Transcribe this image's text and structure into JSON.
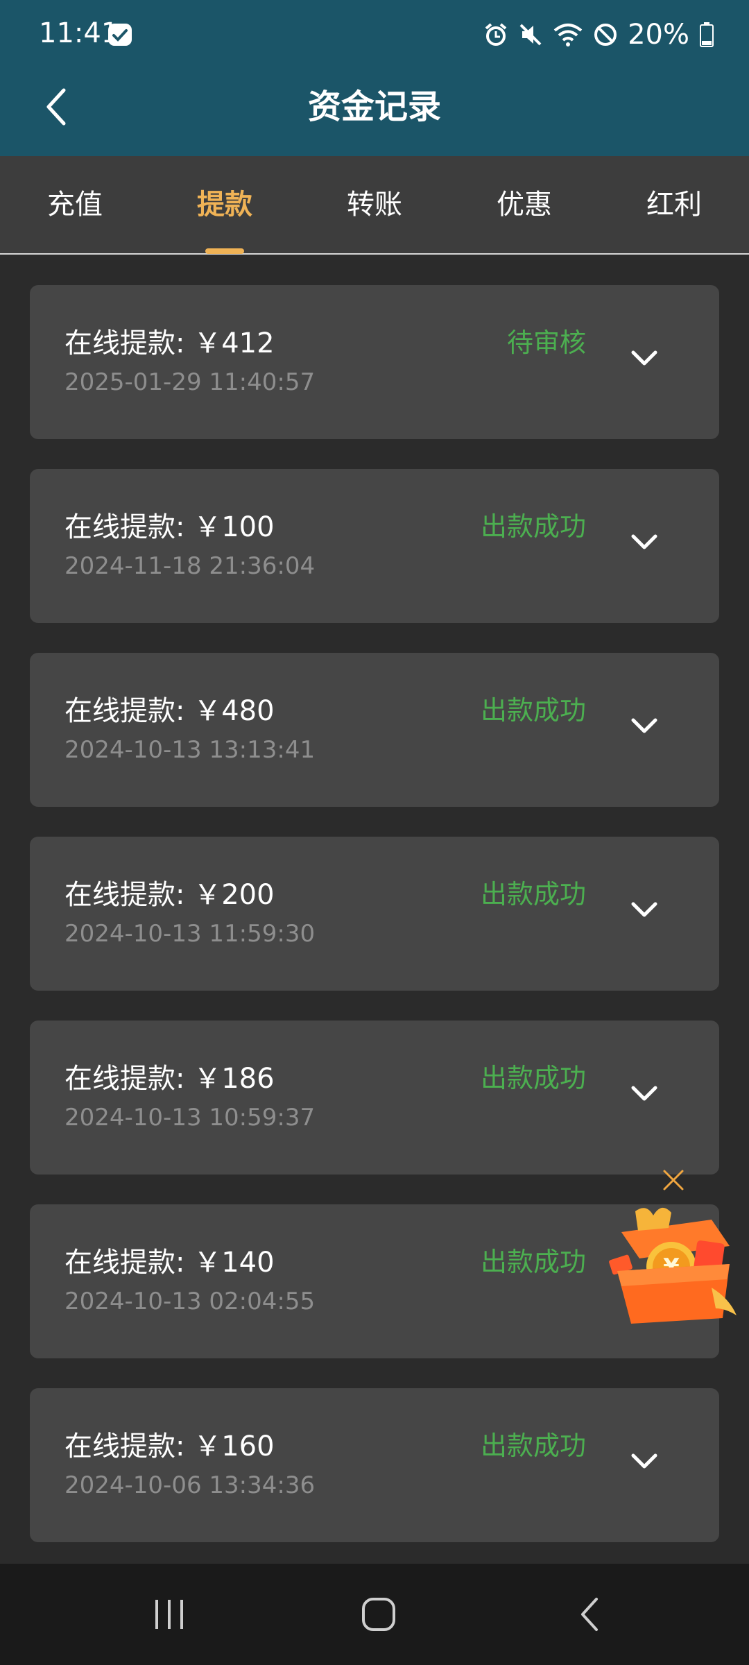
{
  "status_bar": {
    "time": "11:41",
    "battery": "20%",
    "icons": [
      "alarm-icon",
      "mute-icon",
      "wifi-icon",
      "dnd-icon",
      "battery-icon"
    ]
  },
  "header": {
    "title": "资金记录",
    "back_icon": "chevron-left-icon",
    "background": "#1b5568"
  },
  "tabs": [
    {
      "label": "充值",
      "active": false
    },
    {
      "label": "提款",
      "active": true
    },
    {
      "label": "转账",
      "active": false
    },
    {
      "label": "优惠",
      "active": false
    },
    {
      "label": "红利",
      "active": false
    }
  ],
  "accent_color": "#f0b356",
  "status_color": "#4caf50",
  "records": [
    {
      "title": "在线提款: ￥412",
      "time": "2025-01-29 11:40:57",
      "status": "待审核"
    },
    {
      "title": "在线提款: ￥100",
      "time": "2024-11-18 21:36:04",
      "status": "出款成功"
    },
    {
      "title": "在线提款: ￥480",
      "time": "2024-10-13 13:13:41",
      "status": "出款成功"
    },
    {
      "title": "在线提款: ￥200",
      "time": "2024-10-13 11:59:30",
      "status": "出款成功"
    },
    {
      "title": "在线提款: ￥186",
      "time": "2024-10-13 10:59:37",
      "status": "出款成功"
    },
    {
      "title": "在线提款: ￥140",
      "time": "2024-10-13 02:04:55",
      "status": "出款成功"
    },
    {
      "title": "在线提款: ￥160",
      "time": "2024-10-06 13:34:36",
      "status": "出款成功"
    }
  ],
  "floating_promo": {
    "icon": "gift-box-icon",
    "close_icon": "close-icon"
  },
  "nav_bar": {
    "icons": [
      "recent-apps-icon",
      "home-icon",
      "back-icon"
    ]
  }
}
